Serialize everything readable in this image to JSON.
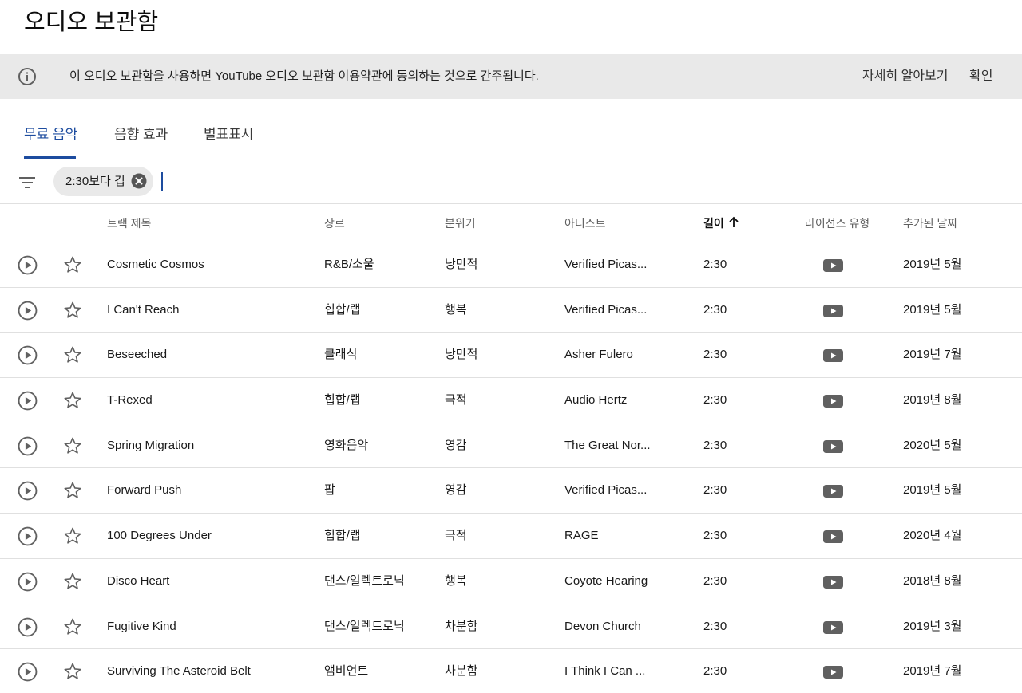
{
  "page": {
    "title": "오디오 보관함"
  },
  "banner": {
    "icon": "info-icon",
    "message": "이 오디오 보관함을 사용하면 YouTube 오디오 보관함 이용약관에 동의하는 것으로 간주됩니다.",
    "learn_more": "자세히 알아보기",
    "confirm": "확인"
  },
  "tabs": [
    {
      "label": "무료 음악",
      "active": true
    },
    {
      "label": "음향 효과",
      "active": false
    },
    {
      "label": "별표표시",
      "active": false
    }
  ],
  "filter": {
    "icon": "filter-icon",
    "chip_label": "2:30보다 깁",
    "chip_close_icon": "close-circle-icon"
  },
  "table": {
    "columns": {
      "title": "트랙 제목",
      "genre": "장르",
      "mood": "분위기",
      "artist": "아티스트",
      "length": "길이",
      "license": "라이선스 유형",
      "added": "추가된 날짜"
    },
    "sort": {
      "column": "length",
      "direction": "ascending",
      "icon": "arrow-up-icon"
    },
    "rows": [
      {
        "title": "Cosmetic Cosmos",
        "genre": "R&B/소울",
        "mood": "낭만적",
        "artist": "Verified Picas...",
        "length": "2:30",
        "license_icon": "youtube-icon",
        "added": "2019년 5월"
      },
      {
        "title": "I Can't Reach",
        "genre": "힙합/랩",
        "mood": "행복",
        "artist": "Verified Picas...",
        "length": "2:30",
        "license_icon": "youtube-icon",
        "added": "2019년 5월"
      },
      {
        "title": "Beseeched",
        "genre": "클래식",
        "mood": "낭만적",
        "artist": "Asher Fulero",
        "length": "2:30",
        "license_icon": "youtube-icon",
        "added": "2019년 7월"
      },
      {
        "title": "T-Rexed",
        "genre": "힙합/랩",
        "mood": "극적",
        "artist": "Audio Hertz",
        "length": "2:30",
        "license_icon": "youtube-icon",
        "added": "2019년 8월"
      },
      {
        "title": "Spring Migration",
        "genre": "영화음악",
        "mood": "영감",
        "artist": "The Great Nor...",
        "length": "2:30",
        "license_icon": "youtube-icon",
        "added": "2020년 5월"
      },
      {
        "title": "Forward Push",
        "genre": "팝",
        "mood": "영감",
        "artist": "Verified Picas...",
        "length": "2:30",
        "license_icon": "youtube-icon",
        "added": "2019년 5월"
      },
      {
        "title": "100 Degrees Under",
        "genre": "힙합/랩",
        "mood": "극적",
        "artist": "RAGE",
        "length": "2:30",
        "license_icon": "youtube-icon",
        "added": "2020년 4월"
      },
      {
        "title": "Disco Heart",
        "genre": "댄스/일렉트로닉",
        "mood": "행복",
        "artist": "Coyote Hearing",
        "length": "2:30",
        "license_icon": "youtube-icon",
        "added": "2018년 8월"
      },
      {
        "title": "Fugitive Kind",
        "genre": "댄스/일렉트로닉",
        "mood": "차분함",
        "artist": "Devon Church",
        "length": "2:30",
        "license_icon": "youtube-icon",
        "added": "2019년 3월"
      },
      {
        "title": "Surviving The Asteroid Belt",
        "genre": "앰비언트",
        "mood": "차분함",
        "artist": "I Think I Can ...",
        "length": "2:30",
        "license_icon": "youtube-icon",
        "added": "2019년 7월"
      }
    ]
  },
  "colors": {
    "accent": "#1d4c9f",
    "banner_bg": "#e9e9e9",
    "divider": "#e0e0e0",
    "icon_gray": "#606060"
  }
}
